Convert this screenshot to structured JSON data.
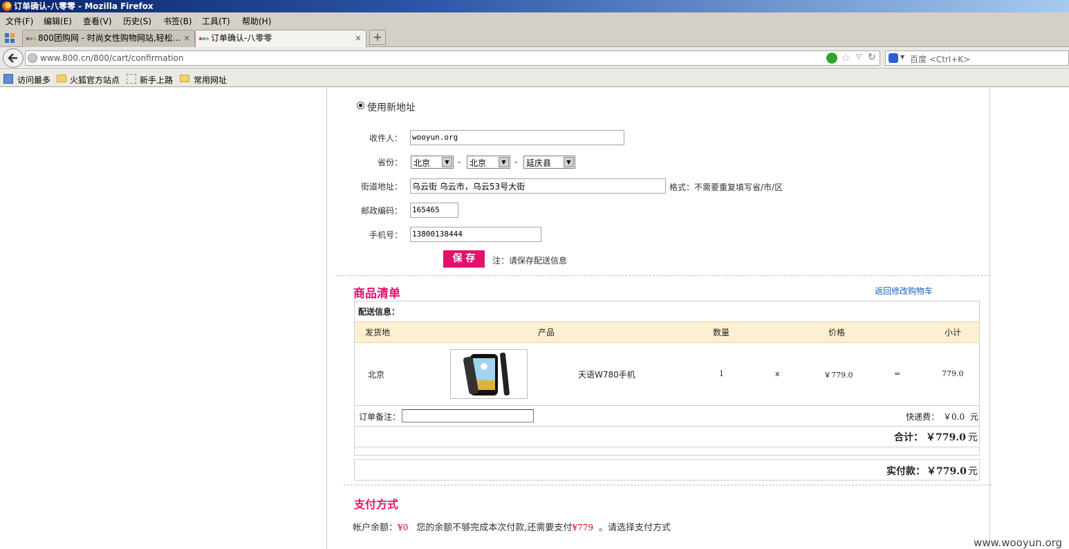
{
  "window": {
    "title": "订单确认-八零零 - Mozilla Firefox"
  },
  "menu": [
    "文件(F)",
    "编辑(E)",
    "查看(V)",
    "历史(S)",
    "书签(B)",
    "工具(T)",
    "帮助(H)"
  ],
  "tabs": [
    {
      "label": "800团购网 - 时尚女性购物网站,轻松...",
      "active": false
    },
    {
      "label": "订单确认-八零零",
      "active": true
    }
  ],
  "address": {
    "url": "www.800.cn/800/cart/confirmation"
  },
  "search": {
    "placeholder": "百度 <Ctrl+K>"
  },
  "bookmarks": [
    "访问最多",
    "火狐官方站点",
    "新手上路",
    "常用网址"
  ],
  "address_form": {
    "radio_label": "使用新地址",
    "receiver_label": "收件人：",
    "receiver_value": "wooyun.org",
    "province_label": "省份：",
    "province": "北京",
    "city": "北京",
    "district": "延庆县",
    "street_label": "街道地址：",
    "street_value": "乌云街 乌云市，乌云53号大街",
    "street_hint": "格式：不需要重复填写省/市/区",
    "zip_label": "邮政编码：",
    "zip_value": "165465",
    "phone_label": "手机号：",
    "phone_value": "13800138444",
    "save_label": "保 存",
    "save_note": "注：请保存配送信息"
  },
  "goods": {
    "title": "商品清单",
    "back_link": "返回修改购物车",
    "delivery_label": "配送信息：",
    "headers": [
      "发货地",
      "产品",
      "数量",
      "价格",
      "小计"
    ],
    "row": {
      "origin": "北京",
      "product": "天语W780手机",
      "qty": "1",
      "times": "x",
      "price": "￥779.0",
      "equals": "=",
      "subtotal": "779.0"
    },
    "remark_label": "订单备注：",
    "shipping_label": "快递费：",
    "shipping_value": "￥0.0",
    "unit": "元",
    "total_label": "合计：",
    "total_value": "￥779.0",
    "pay_label": "实付款：",
    "pay_value": "￥779.0"
  },
  "payment": {
    "title": "支付方式",
    "balance_label": "帐户余额：",
    "balance_value": "¥0",
    "msg_pre": "您的余额不够完成本次付款,还需要支付",
    "need_value": "¥779",
    "msg_post": "。请选择支付方式"
  },
  "watermark": "www.wooyun.org",
  "colors": {
    "accent": "#e4106e",
    "price": "#d0021b",
    "header_bg": "#fdf0d2",
    "link": "#1a5fb4"
  }
}
